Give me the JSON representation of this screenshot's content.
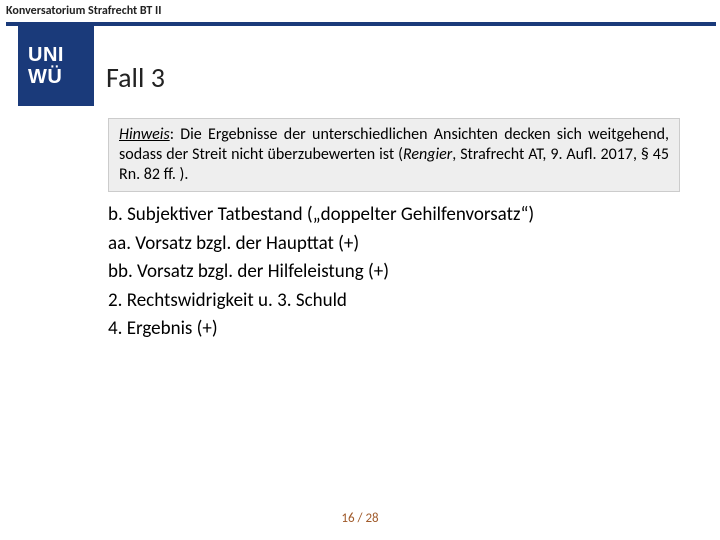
{
  "header": {
    "course": "Konversatorium Strafrecht BT II"
  },
  "logo": {
    "line1": "UNI",
    "line2": "WÜ"
  },
  "title": "Fall 3",
  "hint": {
    "lead": "Hinweis",
    "body": ": Die Ergebnisse der unterschiedlichen Ansichten decken sich weitgehend, sodass der Streit nicht überzubewerten ist (",
    "ref": "Rengier",
    "tail": ", Strafrecht AT, 9. Aufl. 2017, § 45 Rn. 82 ff. )."
  },
  "outline": [
    "b. Subjektiver Tatbestand („doppelter Gehilfenvorsatz“)",
    "aa. Vorsatz bzgl. der Haupttat (+)",
    "bb. Vorsatz bzgl. der Hilfeleistung (+)",
    "2. Rechtswidrigkeit u. 3. Schuld",
    "4. Ergebnis (+)"
  ],
  "pager": {
    "current": "16",
    "sep": " / ",
    "total": "28"
  }
}
